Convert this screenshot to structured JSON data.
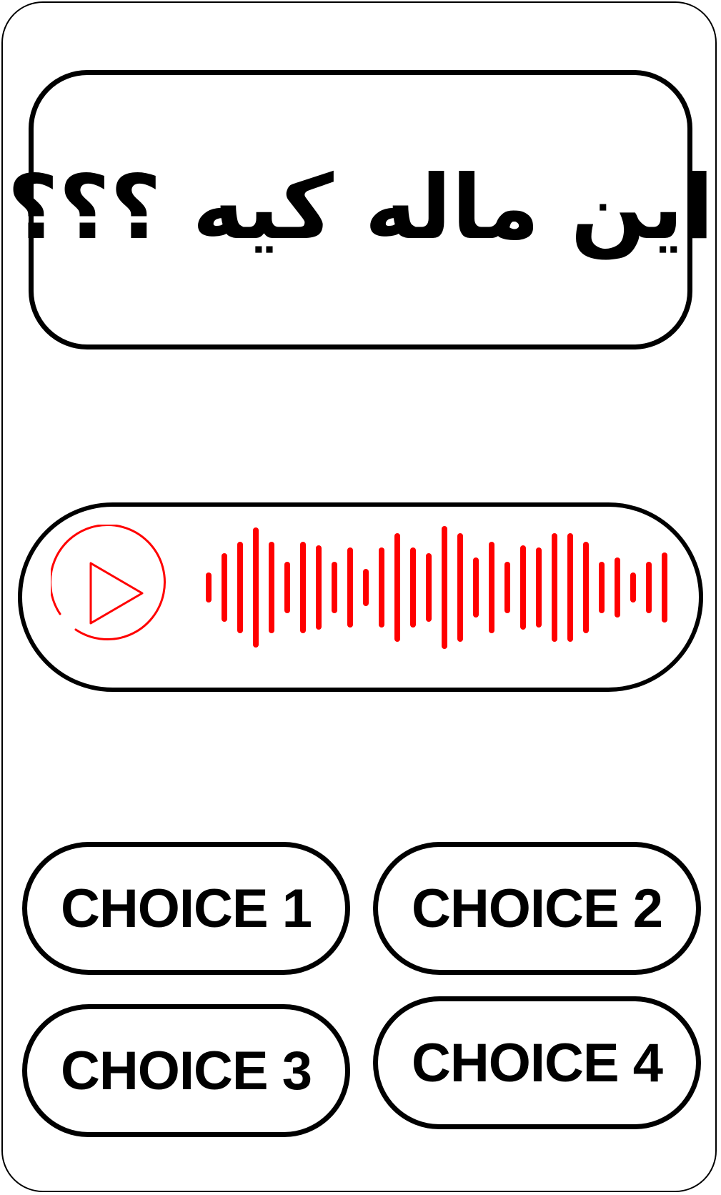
{
  "question": {
    "text": "این ماله کیه ؟؟؟"
  },
  "audio_player": {
    "play_icon": "play-icon",
    "waveform_icon": "audio-waveform-icon",
    "accent_color": "#ff0000"
  },
  "choices": [
    {
      "label": "CHOICE 1"
    },
    {
      "label": "CHOICE 2"
    },
    {
      "label": "CHOICE 3"
    },
    {
      "label": "CHOICE 4"
    }
  ]
}
